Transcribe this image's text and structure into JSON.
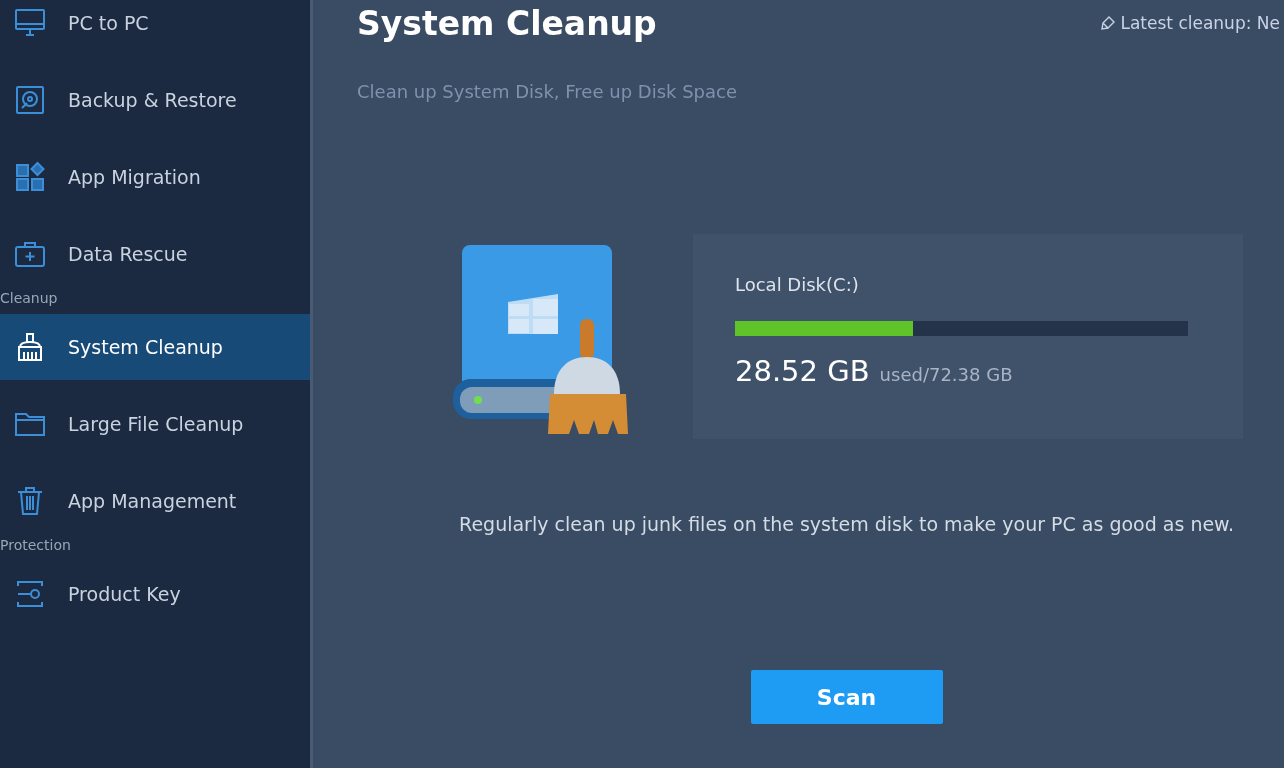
{
  "sidebar": [
    {
      "kind": "item",
      "label": "PC to PC",
      "selected": false
    },
    {
      "kind": "item",
      "label": "Backup & Restore",
      "selected": false
    },
    {
      "kind": "item",
      "label": "App Migration",
      "selected": false
    },
    {
      "kind": "item",
      "label": "Data Rescue",
      "selected": false
    },
    {
      "kind": "heading",
      "label": "Cleanup"
    },
    {
      "kind": "item",
      "label": "System Cleanup",
      "selected": true
    },
    {
      "kind": "item",
      "label": "Large File Cleanup",
      "selected": false
    },
    {
      "kind": "item",
      "label": "App Management",
      "selected": false
    },
    {
      "kind": "heading",
      "label": "Protection"
    },
    {
      "kind": "item",
      "label": "Product Key",
      "selected": false
    }
  ],
  "header": {
    "title": "System Cleanup",
    "subtitle": "Clean up System Disk, Free up Disk Space",
    "latest_cleanup": "Latest cleanup: Ne"
  },
  "disk": {
    "name": "Local Disk(C:)",
    "level": 0.394,
    "used": "28.52 GB",
    "total": "used/72.38 GB"
  },
  "description": "Regularly clean up junk files on the system disk to make your PC as good as new.",
  "button": "Scan"
}
